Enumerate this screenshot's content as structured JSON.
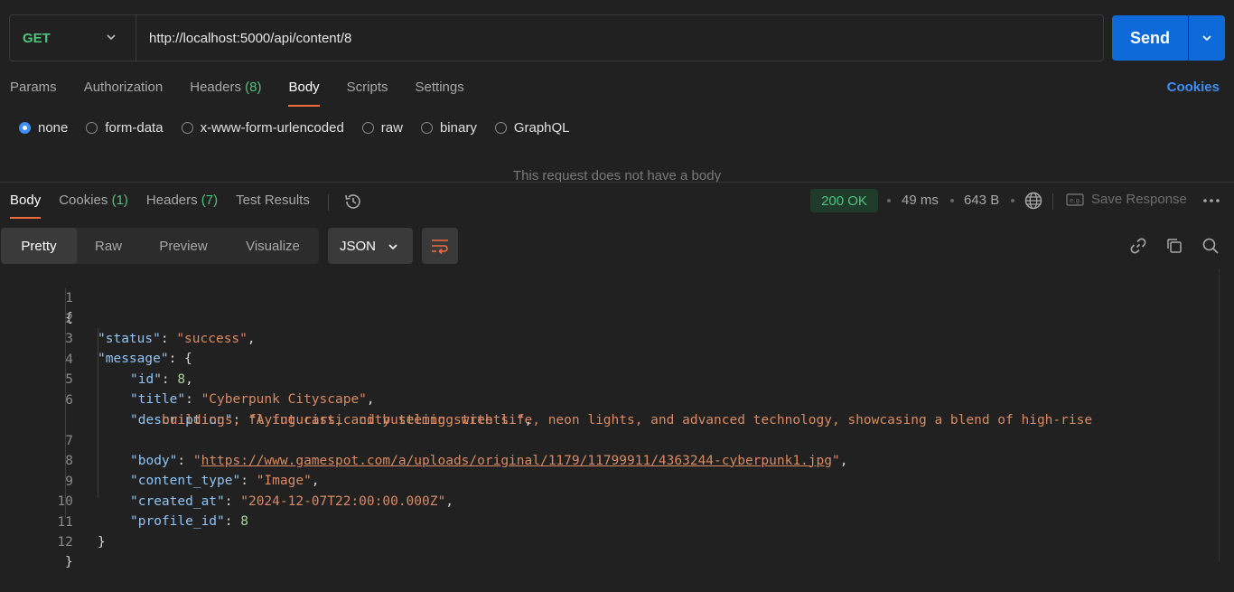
{
  "request": {
    "method": "GET",
    "url": "http://localhost:5000/api/content/8",
    "send_label": "Send"
  },
  "request_tabs": {
    "params": "Params",
    "authorization": "Authorization",
    "headers": "Headers",
    "headers_count": "(8)",
    "body": "Body",
    "scripts": "Scripts",
    "settings": "Settings",
    "cookies": "Cookies"
  },
  "body_types": {
    "none": "none",
    "form_data": "form-data",
    "urlencoded": "x-www-form-urlencoded",
    "raw": "raw",
    "binary": "binary",
    "graphql": "GraphQL",
    "selected": "none",
    "empty_message": "This request does not have a body"
  },
  "response_tabs": {
    "body": "Body",
    "cookies": "Cookies",
    "cookies_count": "(1)",
    "headers": "Headers",
    "headers_count": "(7)",
    "test_results": "Test Results"
  },
  "response_meta": {
    "status": "200 OK",
    "time": "49 ms",
    "size": "643 B",
    "save_response": "Save Response"
  },
  "view_modes": {
    "pretty": "Pretty",
    "raw": "Raw",
    "preview": "Preview",
    "visualize": "Visualize",
    "format": "JSON"
  },
  "code": {
    "line_numbers": [
      "1",
      "2",
      "3",
      "4",
      "5",
      "6",
      "7",
      "8",
      "9",
      "10",
      "11",
      "12"
    ],
    "open_brace": "{",
    "close_brace": "}",
    "status_key": "\"status\"",
    "status_value": "\"success\"",
    "message_key": "\"message\"",
    "id_key": "\"id\"",
    "id_value": "8",
    "title_key": "\"title\"",
    "title_value": "\"Cyberpunk Cityscape\"",
    "description_key": "\"description\"",
    "description_value_1": "\"A futuristic city teeming with life, neon lights, and advanced technology, showcasing a blend of high-rise",
    "description_value_2": "buildings, flying cars, and bustling streets.\"",
    "body_key": "\"body\"",
    "body_value": "https://www.gamespot.com/a/uploads/original/1179/11799911/4363244-cyberpunk1.jpg",
    "content_type_key": "\"content_type\"",
    "content_type_value": "\"Image\"",
    "created_at_key": "\"created_at\"",
    "created_at_value": "\"2024-12-07T22:00:00.000Z\"",
    "profile_id_key": "\"profile_id\"",
    "profile_id_value": "8"
  },
  "icons": {
    "method_dropdown": "chevron-down-icon",
    "send_dropdown": "chevron-down-icon",
    "history": "history-icon",
    "globe": "globe-icon",
    "save": "save-example-icon",
    "more": "more-horizontal-icon",
    "wrap": "wrap-lines-icon",
    "link": "link-icon",
    "copy": "copy-icon",
    "search": "search-icon"
  },
  "colors": {
    "accent_blue": "#0d6ad8",
    "status_green": "#4fc27b",
    "tab_underline": "#f26b3a"
  }
}
